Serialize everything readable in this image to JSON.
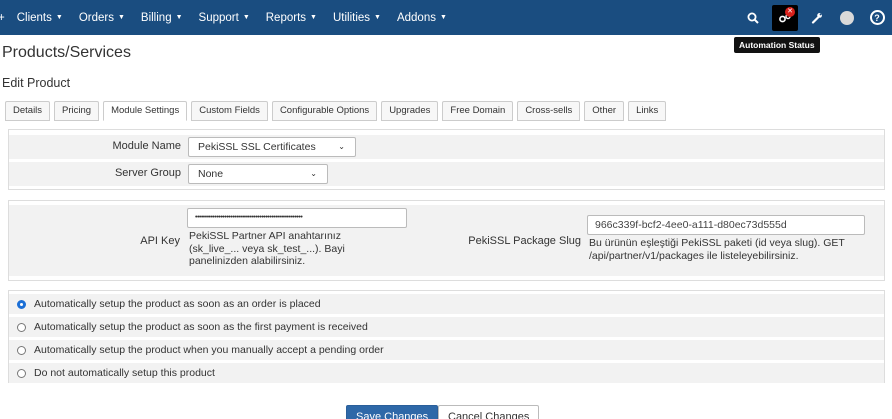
{
  "nav": {
    "plus": "+",
    "items": [
      {
        "label": "Clients"
      },
      {
        "label": "Orders"
      },
      {
        "label": "Billing"
      },
      {
        "label": "Support"
      },
      {
        "label": "Reports"
      },
      {
        "label": "Utilities"
      },
      {
        "label": "Addons"
      }
    ],
    "right_icons": [
      "search-icon",
      "automation-status-icon",
      "wrench-icon",
      "avatar",
      "help-icon"
    ],
    "bg_color": "#1a4d80"
  },
  "tooltip": "Automation Status",
  "page_title": "Products/Services",
  "sub_title": "Edit Product",
  "tabs": [
    {
      "label": "Details"
    },
    {
      "label": "Pricing"
    },
    {
      "label": "Module Settings",
      "active": true
    },
    {
      "label": "Custom Fields"
    },
    {
      "label": "Configurable Options"
    },
    {
      "label": "Upgrades"
    },
    {
      "label": "Free Domain"
    },
    {
      "label": "Cross-sells"
    },
    {
      "label": "Other"
    },
    {
      "label": "Links"
    }
  ],
  "module": {
    "module_name_label": "Module Name",
    "module_name_value": "PekiSSL SSL Certificates",
    "server_group_label": "Server Group",
    "server_group_value": "None"
  },
  "settings": {
    "api_key_label": "API Key",
    "api_key_value": "•••••••••••••••••••••••••••••••••••••••••••••••••••••••",
    "api_key_help": "PekiSSL Partner API anahtarınız (sk_live_... veya sk_test_...). Bayi panelinizden alabilirsiniz.",
    "slug_label": "PekiSSL Package Slug",
    "slug_value": "966c339f-bcf2-4ee0-a111-d80ec73d555d",
    "slug_help": "Bu ürünün eşleştiği PekiSSL paketi (id veya slug). GET /api/partner/v1/packages ile listeleyebilirsiniz."
  },
  "setup_options": [
    {
      "label": "Automatically setup the product as soon as an order is placed",
      "checked": true
    },
    {
      "label": "Automatically setup the product as soon as the first payment is received",
      "checked": false
    },
    {
      "label": "Automatically setup the product when you manually accept a pending order",
      "checked": false
    },
    {
      "label": "Do not automatically setup this product",
      "checked": false
    }
  ],
  "buttons": {
    "save": "Save Changes",
    "cancel": "Cancel Changes"
  }
}
